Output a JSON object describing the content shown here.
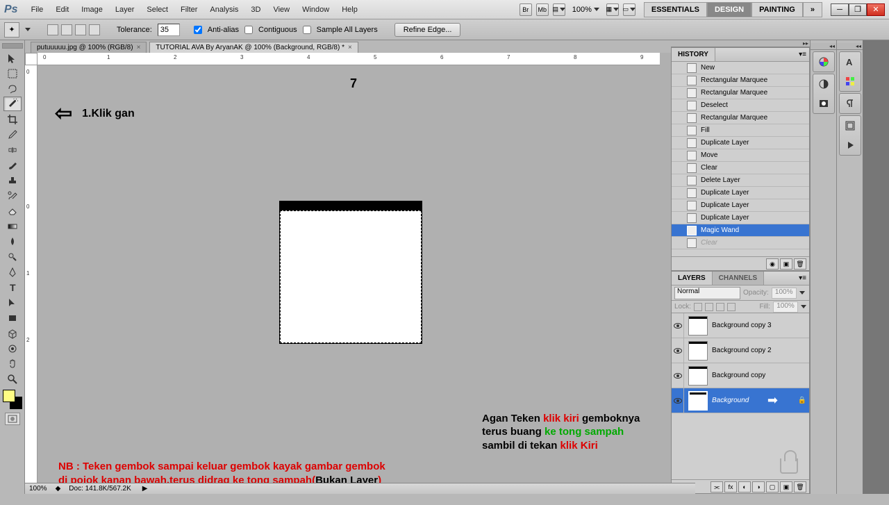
{
  "menubar": {
    "items": [
      "File",
      "Edit",
      "Image",
      "Layer",
      "Select",
      "Filter",
      "Analysis",
      "3D",
      "View",
      "Window",
      "Help"
    ],
    "zoom": "100%",
    "workspaces": [
      "ESSENTIALS",
      "DESIGN",
      "PAINTING"
    ],
    "active_workspace": 1
  },
  "options": {
    "tolerance_label": "Tolerance:",
    "tolerance_value": "35",
    "antialias": "Anti-alias",
    "contiguous": "Contiguous",
    "sample_all": "Sample All Layers",
    "refine": "Refine Edge..."
  },
  "doctabs": [
    {
      "title": "putuuuuu.jpg @ 100% (RGB/8)",
      "active": false
    },
    {
      "title": "TUTORIAL AVA By AryanAK @ 100% (Background, RGB/8) *",
      "active": true
    }
  ],
  "canvas": {
    "page_number": "7",
    "arrow_label": "1.Klik gan",
    "annot_right_l1_a": "Agan Teken ",
    "annot_right_l1_b": "klik kiri ",
    "annot_right_l1_c": "gemboknya",
    "annot_right_l2_a": "terus buang ",
    "annot_right_l2_b": "ke tong sampah",
    "annot_right_l3_a": "sambil di tekan ",
    "annot_right_l3_b": "klik Kiri",
    "annot_bottom_l1": "NB : Teken gembok sampai keluar gembok kayak gambar gembok",
    "annot_bottom_l2_a": "di pojok kanan bawah,terus didrag ke tong sampah(",
    "annot_bottom_l2_b": "Bukan Layer",
    "annot_bottom_l2_c": ")"
  },
  "history": {
    "title": "HISTORY",
    "items": [
      {
        "label": "New"
      },
      {
        "label": "Rectangular Marquee"
      },
      {
        "label": "Rectangular Marquee"
      },
      {
        "label": "Deselect"
      },
      {
        "label": "Rectangular Marquee"
      },
      {
        "label": "Fill"
      },
      {
        "label": "Duplicate Layer"
      },
      {
        "label": "Move"
      },
      {
        "label": "Clear"
      },
      {
        "label": "Delete Layer"
      },
      {
        "label": "Duplicate Layer"
      },
      {
        "label": "Duplicate Layer"
      },
      {
        "label": "Duplicate Layer"
      },
      {
        "label": "Magic Wand",
        "selected": true
      },
      {
        "label": "Clear",
        "dimmed": true
      }
    ]
  },
  "layers": {
    "tab1": "LAYERS",
    "tab2": "CHANNELS",
    "blend": "Normal",
    "opacity_label": "Opacity:",
    "opacity": "100%",
    "lock_label": "Lock:",
    "fill_label": "Fill:",
    "fill": "100%",
    "items": [
      {
        "name": "Background copy 3"
      },
      {
        "name": "Background copy 2"
      },
      {
        "name": "Background copy"
      },
      {
        "name": "Background",
        "selected": true,
        "locked": true
      }
    ]
  },
  "status": {
    "zoom": "100%",
    "doc": "Doc: 141.8K/567.2K"
  }
}
